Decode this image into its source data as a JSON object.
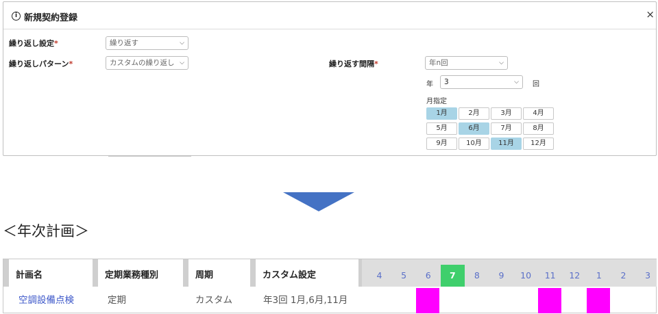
{
  "dialog": {
    "title": "新規契約登録",
    "close": "×",
    "fields": {
      "repeat_setting": {
        "label": "繰り返し設定",
        "required": "*",
        "value": "繰り返す"
      },
      "repeat_pattern": {
        "label": "繰り返しパターン",
        "required": "*",
        "value": "カスタムの繰り返し"
      },
      "repeat_interval": {
        "label": "繰り返す間隔",
        "required": "*",
        "value": "年n回"
      },
      "year": {
        "label": "年",
        "value": "3",
        "unit": "回"
      },
      "month_spec": {
        "label": "月指定"
      }
    },
    "months": [
      {
        "label": "1月",
        "selected": true
      },
      {
        "label": "2月",
        "selected": false
      },
      {
        "label": "3月",
        "selected": false
      },
      {
        "label": "4月",
        "selected": false
      },
      {
        "label": "5月",
        "selected": false
      },
      {
        "label": "6月",
        "selected": true
      },
      {
        "label": "7月",
        "selected": false
      },
      {
        "label": "8月",
        "selected": false
      },
      {
        "label": "9月",
        "selected": false
      },
      {
        "label": "10月",
        "selected": false
      },
      {
        "label": "11月",
        "selected": true
      },
      {
        "label": "12月",
        "selected": false
      }
    ],
    "selected_color": "#a8d4e6"
  },
  "annual_plan": {
    "title": "＜年次計画＞",
    "headers": [
      "計画名",
      "定期業務種別",
      "周期",
      "カスタム設定"
    ],
    "months": [
      "4",
      "5",
      "6",
      "7",
      "8",
      "9",
      "10",
      "11",
      "12",
      "1",
      "2",
      "3"
    ],
    "current_month": "7",
    "row": {
      "name": "空調設備点検",
      "type": "定期",
      "cycle": "カスタム",
      "custom": "年3回 1月,6月,11月",
      "scheduled_months": [
        "6",
        "11",
        "1"
      ]
    },
    "colors": {
      "current": "#3fcf6c",
      "scheduled": "#ff00ff",
      "month_text": "#5a6fc8"
    }
  }
}
